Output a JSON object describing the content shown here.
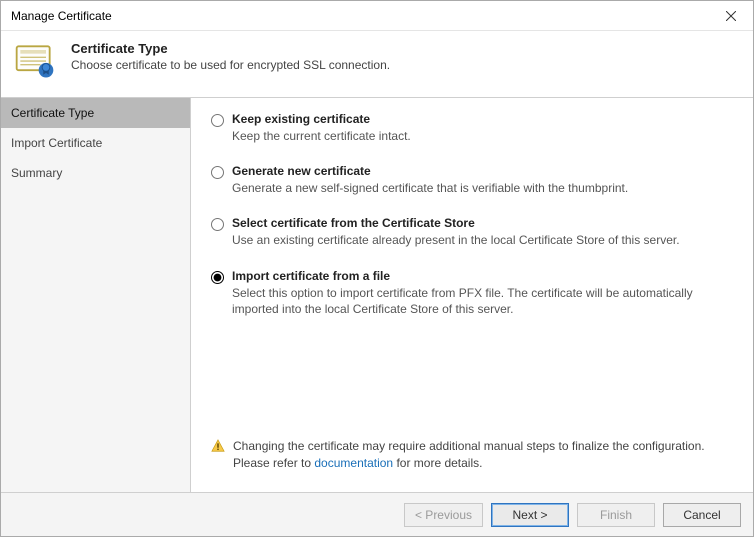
{
  "window": {
    "title": "Manage Certificate"
  },
  "header": {
    "title": "Certificate Type",
    "subtitle": "Choose certificate to be used for encrypted SSL connection."
  },
  "sidebar": {
    "items": [
      {
        "label": "Certificate Type",
        "active": true
      },
      {
        "label": "Import Certificate",
        "active": false
      },
      {
        "label": "Summary",
        "active": false
      }
    ]
  },
  "options": [
    {
      "id": "keep",
      "title": "Keep existing certificate",
      "desc": "Keep the current certificate intact.",
      "selected": false
    },
    {
      "id": "generate",
      "title": "Generate new certificate",
      "desc": "Generate a new self-signed certificate that is verifiable with the thumbprint.",
      "selected": false
    },
    {
      "id": "store",
      "title": "Select certificate from the Certificate Store",
      "desc": "Use an existing certificate already present in the local Certificate Store of this server.",
      "selected": false
    },
    {
      "id": "import",
      "title": "Import certificate from a file",
      "desc": "Select this option to import certificate from PFX file. The certificate will be automatically imported into the local Certificate Store of this server.",
      "selected": true
    }
  ],
  "notice": {
    "text_before": "Changing the certificate may require additional manual steps to finalize the configuration. Please refer to ",
    "link_text": "documentation",
    "text_after": " for more details."
  },
  "buttons": {
    "previous": "< Previous",
    "next": "Next >",
    "finish": "Finish",
    "cancel": "Cancel"
  }
}
